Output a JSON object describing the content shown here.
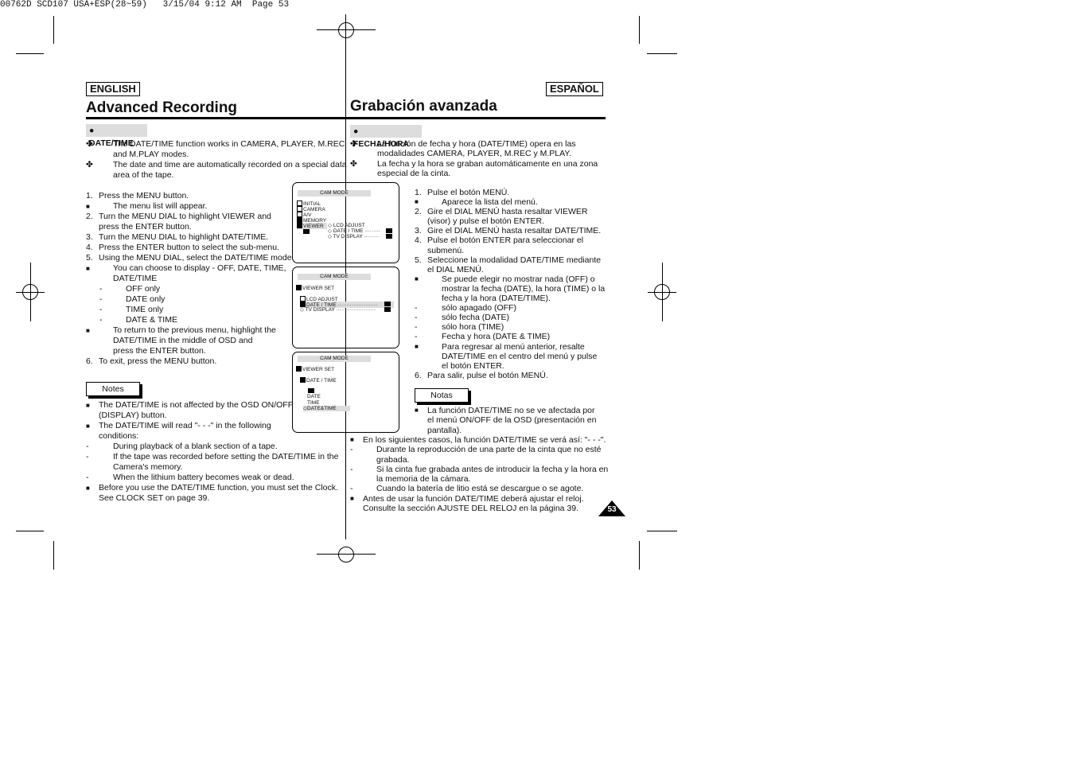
{
  "header": "00762D SCD107 USA+ESP(28~59)   3/15/04 9:12 AM  Page 53",
  "english": {
    "lang": "ENGLISH",
    "title": "Advanced Recording",
    "section": "DATE/TIME",
    "intro": [
      {
        "m": "✤",
        "t": "The DATE/TIME function works in CAMERA, PLAYER, M.REC",
        "i": 1
      },
      {
        "m": "",
        "t": "and M.PLAY modes.",
        "i": 1
      },
      {
        "m": "✤",
        "t": "The date and time are automatically recorded on a special data",
        "i": 1
      },
      {
        "m": "",
        "t": "area of the tape.",
        "i": 1
      }
    ],
    "steps": [
      {
        "m": "1.",
        "t": "Press the MENU button.",
        "i": 0
      },
      {
        "m": "■",
        "t": "The menu list will appear.",
        "i": 1
      },
      {
        "m": "2.",
        "t": "Turn the MENU DIAL to highlight VIEWER and",
        "i": 0
      },
      {
        "m": "",
        "t": "press the ENTER button.",
        "i": 0
      },
      {
        "m": "3.",
        "t": "Turn the MENU DIAL to highlight DATE/TIME.",
        "i": 0
      },
      {
        "m": "4.",
        "t": "Press the ENTER button to select the sub-menu.",
        "i": 0
      },
      {
        "m": "5.",
        "t": "Using the MENU DIAL, select the DATE/TIME mode.",
        "i": 0
      },
      {
        "m": "■",
        "t": "You can choose to display - OFF, DATE, TIME,",
        "i": 1
      },
      {
        "m": "",
        "t": "DATE/TIME",
        "i": 1
      },
      {
        "m": "-",
        "t": "OFF only",
        "i": 2
      },
      {
        "m": "-",
        "t": "DATE only",
        "i": 2
      },
      {
        "m": "-",
        "t": "TIME only",
        "i": 2
      },
      {
        "m": "-",
        "t": "DATE & TIME",
        "i": 2
      },
      {
        "m": "■",
        "t": "To return to the previous menu, highlight the",
        "i": 1
      },
      {
        "m": "",
        "t": "DATE/TIME in the middle of OSD and",
        "i": 1
      },
      {
        "m": "",
        "t": "press the ENTER button.",
        "i": 1
      },
      {
        "m": "6.",
        "t": "To exit, press the MENU button.",
        "i": 0
      }
    ],
    "notes_label": "Notes",
    "notes": [
      {
        "m": "■",
        "t": "The DATE/TIME is not affected by the OSD ON/OFF",
        "i": 0
      },
      {
        "m": "",
        "t": "(DISPLAY) button.",
        "i": 0
      },
      {
        "m": "■",
        "t": "The DATE/TIME will read \"- - -\" in the following",
        "i": 0
      },
      {
        "m": "",
        "t": "conditions:",
        "i": 0
      },
      {
        "m": "-",
        "t": "During playback of a blank section of a tape.",
        "i": 1
      },
      {
        "m": "-",
        "t": "If the tape was recorded before setting the DATE/TIME in the",
        "i": 1
      },
      {
        "m": "",
        "t": "Camera's memory.",
        "i": 1
      },
      {
        "m": "-",
        "t": "When the lithium battery becomes weak or dead.",
        "i": 1
      },
      {
        "m": "■",
        "t": "Before you use the DATE/TIME function, you must set the Clock.",
        "i": 0
      },
      {
        "m": "",
        "t": "See CLOCK SET on page 39.",
        "i": 0
      }
    ]
  },
  "espanol": {
    "lang": "ESPAÑOL",
    "title": "Grabación avanzada",
    "section": "FECHA/HORA",
    "intro": [
      {
        "m": "✤",
        "t": "La función de fecha y hora (DATE/TIME) opera en las",
        "i": 1
      },
      {
        "m": "",
        "t": "modalidades CAMERA, PLAYER, M.REC y M.PLAY.",
        "i": 1
      },
      {
        "m": "✤",
        "t": "La fecha y la hora se graban automáticamente en una zona",
        "i": 1
      },
      {
        "m": "",
        "t": "especial de la cinta.",
        "i": 1
      }
    ],
    "steps": [
      {
        "m": "1.",
        "t": "Pulse el botón MENÚ.",
        "i": 0
      },
      {
        "m": "■",
        "t": "Aparece la lista del menú.",
        "i": 1
      },
      {
        "m": "2.",
        "t": "Gire el DIAL MENÚ hasta resaltar VIEWER",
        "i": 0
      },
      {
        "m": "",
        "t": "(visor) y pulse el botón ENTER.",
        "i": 0
      },
      {
        "m": "3.",
        "t": "Gire el DIAL MENÚ hasta resaltar DATE/TIME.",
        "i": 0
      },
      {
        "m": "4.",
        "t": "Pulse el botón ENTER para seleccionar el",
        "i": 0
      },
      {
        "m": "",
        "t": "submenú.",
        "i": 0
      },
      {
        "m": "5.",
        "t": "Seleccione la modalidad DATE/TIME mediante",
        "i": 0
      },
      {
        "m": "",
        "t": "el DIAL MENÚ.",
        "i": 0
      },
      {
        "m": "■",
        "t": "Se puede elegir no mostrar nada (OFF) o",
        "i": 1
      },
      {
        "m": "",
        "t": "mostrar la fecha (DATE), la hora (TIME) o la",
        "i": 1
      },
      {
        "m": "",
        "t": "fecha y la hora (DATE/TIME).",
        "i": 1
      },
      {
        "m": "-",
        "t": "sólo apagado (OFF)",
        "i": 1
      },
      {
        "m": "-",
        "t": "sólo fecha (DATE)",
        "i": 1
      },
      {
        "m": "-",
        "t": "sólo hora (TIME)",
        "i": 1
      },
      {
        "m": "-",
        "t": "Fecha y hora (DATE & TIME)",
        "i": 1
      },
      {
        "m": "■",
        "t": "Para regresar al menú anterior, resalte",
        "i": 1
      },
      {
        "m": "",
        "t": "DATE/TIME en el centro del menú y pulse",
        "i": 1
      },
      {
        "m": "",
        "t": "el botón ENTER.",
        "i": 1
      },
      {
        "m": "6.",
        "t": "Para salir, pulse el botón MENÚ.",
        "i": 0
      }
    ],
    "notes_label": "Notas",
    "notes": [
      {
        "m": "■",
        "t": "La función DATE/TIME no se ve afectada por",
        "i": 0
      },
      {
        "m": "",
        "t": "el menú ON/OFF de la OSD (presentación en",
        "i": 0
      },
      {
        "m": "",
        "t": "pantalla).",
        "i": 0
      }
    ],
    "notes2": [
      {
        "m": "■",
        "t": "En los siguientes casos, la función DATE/TIME se verá así: \"- - -\".",
        "i": 0
      },
      {
        "m": "-",
        "t": "Durante la reproducción de una parte de la cinta que no esté",
        "i": 1
      },
      {
        "m": "",
        "t": "grabada.",
        "i": 1
      },
      {
        "m": "-",
        "t": "Si la cinta fue grabada antes de introducir la fecha y la hora en",
        "i": 1
      },
      {
        "m": "",
        "t": "la memoria de la cámara.",
        "i": 1
      },
      {
        "m": "-",
        "t": "Cuando la batería de litio está se descargue o se agote.",
        "i": 1
      },
      {
        "m": "■",
        "t": "Antes de usar la función DATE/TIME deberá ajustar el reloj.",
        "i": 0
      },
      {
        "m": "",
        "t": "Consulte la sección AJUSTE DEL RELOJ en la página 39.",
        "i": 0
      }
    ]
  },
  "screens": {
    "title": "CAM MODE",
    "s1": [
      "INITIAL",
      "CAMERA",
      "A/V",
      "MEMORY",
      "VIEWER"
    ],
    "s1sub": [
      "LCD ADJUST",
      "DATE / TIME",
      "TV DISPLAY"
    ],
    "viewer_set": "VIEWER SET",
    "s2": [
      "LCD ADJUST",
      "DATE / TIME",
      "TV DISPLAY"
    ],
    "date_time": "DATE / TIME",
    "s3": [
      "DATE",
      "TIME",
      "DATE&TIME"
    ]
  },
  "page_number": "53"
}
